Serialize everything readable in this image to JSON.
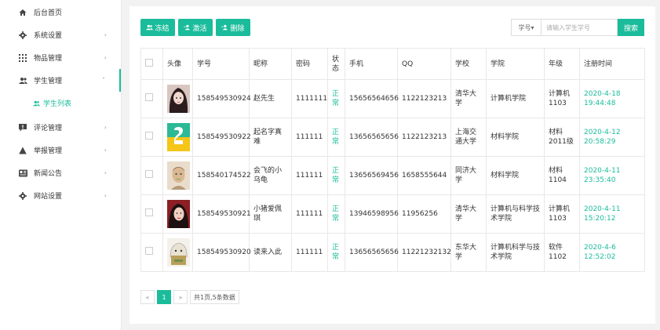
{
  "sidebar": {
    "items": [
      {
        "label": "后台首页",
        "icon": "home-icon"
      },
      {
        "label": "系统设置",
        "icon": "gear-icon"
      },
      {
        "label": "物品管理",
        "icon": "grid-icon"
      },
      {
        "label": "学生管理",
        "icon": "users-icon"
      },
      {
        "label": "评论管理",
        "icon": "comment-icon"
      },
      {
        "label": "举报管理",
        "icon": "warning-icon"
      },
      {
        "label": "新闻公告",
        "icon": "news-icon"
      },
      {
        "label": "网站设置",
        "icon": "gear-icon"
      }
    ],
    "sub_item": {
      "label": "学生列表",
      "icon": "users-icon"
    }
  },
  "toolbar": {
    "freeze_label": "冻结",
    "activate_label": "激活",
    "delete_label": "删除"
  },
  "search": {
    "type_label": "学号",
    "placeholder": "请输入学生学号",
    "button_label": "搜索"
  },
  "table": {
    "headers": [
      "",
      "头像",
      "学号",
      "昵称",
      "密码",
      "状态",
      "手机",
      "QQ",
      "学校",
      "学院",
      "年级",
      "注册时间"
    ],
    "rows": [
      {
        "id": "158549530924",
        "nickname": "赵先生",
        "password": "1111111",
        "status": "正常",
        "phone": "15656564656",
        "qq": "1122123213",
        "school": "清华大学",
        "college": "计算机学院",
        "grade": "计算机1103",
        "time": "2020-4-18 19:44:48"
      },
      {
        "id": "158549530922",
        "nickname": "起名字真难",
        "password": "111111",
        "status": "正常",
        "phone": "13656565656",
        "qq": "1122123213",
        "school": "上海交通大学",
        "college": "材料学院",
        "grade": "材料2011级",
        "time": "2020-4-12 20:58:29"
      },
      {
        "id": "158540174522",
        "nickname": "会飞的小乌龟",
        "password": "111111",
        "status": "正常",
        "phone": "13656569456",
        "qq": "1658555644",
        "school": "同济大学",
        "college": "材料学院",
        "grade": "材料1104",
        "time": "2020-4-11 23:35:40"
      },
      {
        "id": "158549530921",
        "nickname": "小猪爱佩琪",
        "password": "111111",
        "status": "正常",
        "phone": "13946598956",
        "qq": "11956256",
        "school": "清华大学",
        "college": "计算机与科学技术学院",
        "grade": "计算机1103",
        "time": "2020-4-11 15:20:12"
      },
      {
        "id": "158549530920",
        "nickname": "读来入此",
        "password": "111111",
        "status": "正常",
        "phone": "13656565656",
        "qq": "11221232132",
        "school": "东华大学",
        "college": "计算机科学与技术学院",
        "grade": "软件1102",
        "time": "2020-4-6 12:52:02"
      }
    ]
  },
  "pagination": {
    "prev": "«",
    "current": "1",
    "next": "»",
    "info": "共1页,5条数据"
  },
  "colors": {
    "accent": "#1bbc9b"
  }
}
